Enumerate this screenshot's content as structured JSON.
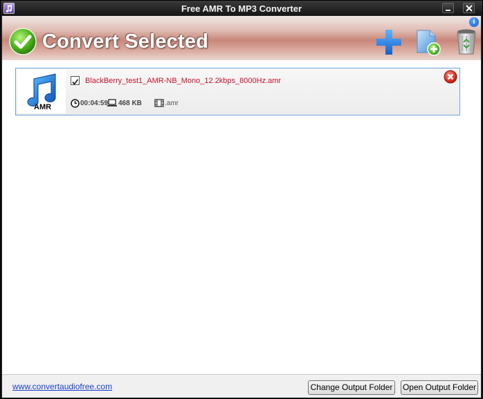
{
  "window": {
    "title": "Free AMR To MP3 Converter"
  },
  "toolbar": {
    "convert_label": "Convert Selected",
    "icons": [
      "check-circle-icon",
      "add-icon",
      "add-folder-icon",
      "trash-icon",
      "info-icon"
    ]
  },
  "files": [
    {
      "checked": true,
      "name": "BlackBerry_test1_AMR-NB_Mono_12.2kbps_8000Hz.amr",
      "thumb_label": "AMR",
      "duration": "00:04:59",
      "size": "468 KB",
      "extension": ".amr"
    }
  ],
  "footer": {
    "website": "www.convertaudiofree.com",
    "change_output_label": "Change Output Folder",
    "open_output_label": "Open Output Folder"
  },
  "colors": {
    "file_name": "#c8102e",
    "link": "#1a3fd0",
    "selection_border": "#6fa3d6"
  }
}
